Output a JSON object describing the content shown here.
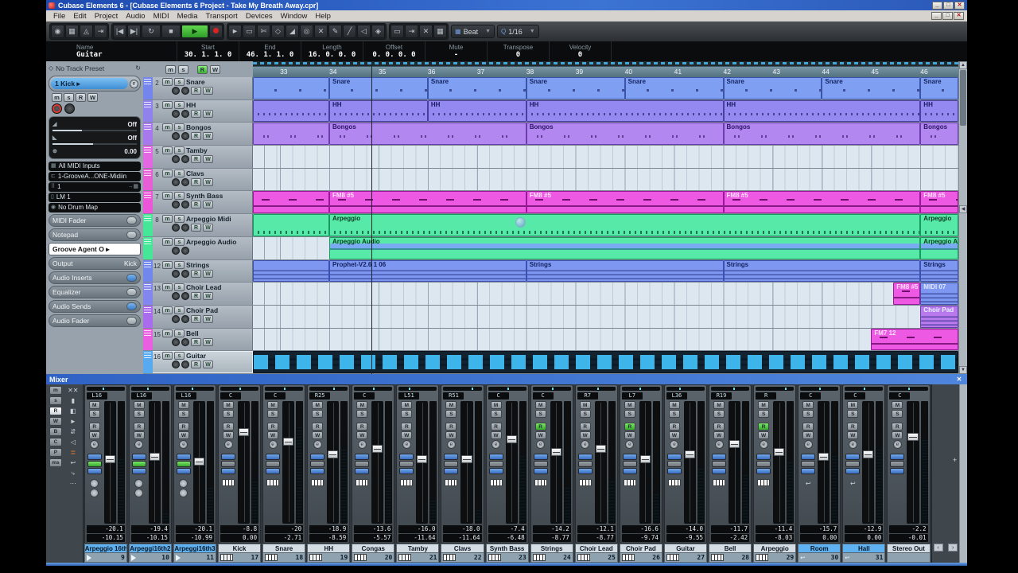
{
  "titlebar": {
    "title": "Cubase Elements 6 - [Cubase Elements 6 Project - Take My Breath Away.cpr]"
  },
  "menubar": {
    "items": [
      "File",
      "Edit",
      "Project",
      "Audio",
      "MIDI",
      "Media",
      "Transport",
      "Devices",
      "Window",
      "Help"
    ]
  },
  "toolbar": {
    "left_buttons": [
      {
        "name": "activate-button",
        "glyph": "◉"
      },
      {
        "name": "setup-button",
        "glyph": "▦"
      },
      {
        "name": "metronome-button",
        "glyph": "◬"
      },
      {
        "name": "automation-read-write-button",
        "glyph": "⇥"
      }
    ],
    "transport": [
      {
        "name": "goto-previous-marker-button",
        "glyph": "|◀"
      },
      {
        "name": "goto-next-marker-button",
        "glyph": "▶|"
      },
      {
        "name": "cycle-button",
        "glyph": "↻"
      },
      {
        "name": "stop-button",
        "glyph": "■"
      },
      {
        "name": "play-button",
        "glyph": "▶"
      },
      {
        "name": "record-button",
        "glyph": ""
      }
    ],
    "tools": [
      {
        "name": "object-select-tool",
        "glyph": "►"
      },
      {
        "name": "range-select-tool",
        "glyph": "▭"
      },
      {
        "name": "split-tool",
        "glyph": "✄"
      },
      {
        "name": "glue-tool",
        "glyph": "◇"
      },
      {
        "name": "erase-tool",
        "glyph": "◢"
      },
      {
        "name": "zoom-tool",
        "glyph": "◎"
      },
      {
        "name": "mute-tool",
        "glyph": "✕"
      },
      {
        "name": "draw-tool",
        "glyph": "✎"
      },
      {
        "name": "line-tool",
        "glyph": "╱"
      },
      {
        "name": "play-tool",
        "glyph": "◁"
      },
      {
        "name": "color-tool",
        "glyph": "◈"
      }
    ],
    "right_buttons": [
      {
        "name": "autoscroll-button",
        "glyph": "▭"
      },
      {
        "name": "snap-button",
        "glyph": "⇥"
      },
      {
        "name": "snap-type-button",
        "glyph": "✕"
      },
      {
        "name": "grid-type-button",
        "glyph": "▦"
      }
    ],
    "grid_mode": "Beat",
    "quantize_label": "Q",
    "quantize": "1/16"
  },
  "info_line": {
    "fields": [
      {
        "label": "Name",
        "value": "Guitar"
      },
      {
        "label": "Start",
        "value": "30. 1. 1. 0"
      },
      {
        "label": "End",
        "value": "46. 1. 1. 0"
      },
      {
        "label": "Length",
        "value": "16. 0. 0. 0"
      },
      {
        "label": "Offset",
        "value": "0. 0. 0. 0"
      },
      {
        "label": "Mute",
        "value": "-"
      },
      {
        "label": "Transpose",
        "value": "0"
      },
      {
        "label": "Velocity",
        "value": "0"
      }
    ]
  },
  "inspector": {
    "preset_label": "No Track Preset",
    "track_number": "1",
    "track_name": "Kick",
    "buttons": [
      "m",
      "s",
      "R",
      "W"
    ],
    "fader": {
      "vol1": "Off",
      "vol2": "Off",
      "pan": "0.00"
    },
    "input": "All MIDI Inputs",
    "routing": "1-GrooveA...ONE-Midiin",
    "channel": "1",
    "instrument": "LM 1",
    "drum_map": "No Drum Map",
    "sections": [
      {
        "label": "MIDI Fader",
        "style": "plain"
      },
      {
        "label": "Notepad",
        "style": "plain"
      },
      {
        "label": "Groove Agent O",
        "style": "combo"
      },
      {
        "label": "Output",
        "value": "Kick",
        "style": "output"
      },
      {
        "label": "Audio Inserts",
        "style": "blue"
      },
      {
        "label": "Equalizer",
        "style": "plain"
      },
      {
        "label": "Audio Sends",
        "style": "blue"
      },
      {
        "label": "Audio Fader",
        "style": "plain"
      }
    ]
  },
  "track_header": {
    "buttons": [
      "m",
      "s",
      "R",
      "W"
    ]
  },
  "view": {
    "bar_start": 32.45,
    "bar_end": 46.77,
    "playhead_bar": 34.85
  },
  "ruler": {
    "bars": [
      "33",
      "34",
      "35",
      "36",
      "37",
      "38",
      "39",
      "40",
      "41",
      "42",
      "43",
      "44",
      "45",
      "46"
    ]
  },
  "tracks": [
    {
      "num": "2",
      "name": "Snare",
      "color": "#7585ee",
      "clip_bg": "#7e9ff2",
      "clip_border": "#3b54aa",
      "pattern": "dots-sparse",
      "label_color": "#14235e",
      "clips": [
        [
          32.45,
          34,
          ""
        ],
        [
          34,
          36,
          "Snare"
        ],
        [
          36,
          38,
          "Snare"
        ],
        [
          38,
          40,
          "Snare"
        ],
        [
          40,
          42,
          "Snare"
        ],
        [
          42,
          44,
          "Snare"
        ],
        [
          44,
          46,
          "Snare"
        ],
        [
          46,
          46.77,
          "Snare"
        ]
      ]
    },
    {
      "num": "3",
      "name": "HH",
      "color": "#8f82ee",
      "clip_bg": "#9489f0",
      "clip_border": "#4a3fa0",
      "pattern": "dots-dense",
      "label_color": "#1c1a66",
      "clips": [
        [
          32.45,
          34,
          ""
        ],
        [
          34,
          36,
          "HH"
        ],
        [
          36,
          38,
          "HH"
        ],
        [
          38,
          42,
          "HH"
        ],
        [
          42,
          46,
          "HH"
        ],
        [
          46,
          46.77,
          "HH"
        ]
      ]
    },
    {
      "num": "4",
      "name": "Bongos",
      "color": "#a878ee",
      "clip_bg": "#b287f0",
      "clip_border": "#6a3cae",
      "pattern": "dots-pairs",
      "label_color": "#2c1466",
      "clips": [
        [
          32.45,
          34,
          ""
        ],
        [
          34,
          38,
          "Bongos"
        ],
        [
          38,
          42,
          "Bongos"
        ],
        [
          42,
          46,
          "Bongos"
        ],
        [
          46,
          46.77,
          "Bongos"
        ]
      ]
    },
    {
      "num": "5",
      "name": "Tamby",
      "color": "#e366e2",
      "clips": []
    },
    {
      "num": "6",
      "name": "Clavs",
      "color": "#e85ed6",
      "clips": []
    },
    {
      "num": "7",
      "name": "Synth Bass",
      "color": "#ee56da",
      "clip_bg": "#ee59e4",
      "clip_border": "#99189a",
      "pattern": "bass",
      "label_color": "#ffe2fb",
      "clips": [
        [
          32.45,
          34,
          ""
        ],
        [
          34,
          38,
          "FM8 #5"
        ],
        [
          38,
          42,
          "FM8 #5"
        ],
        [
          42,
          46,
          "FM8 #5"
        ],
        [
          46,
          46.77,
          "FM8 #5"
        ]
      ]
    },
    {
      "num": "8",
      "name": "Arpeggio Midi",
      "color": "#46e698",
      "clip_bg": "#57e9a7",
      "clip_border": "#169a5e",
      "pattern": "ticks",
      "label_color": "#0c3a22",
      "clips": [
        [
          32.45,
          34,
          ""
        ],
        [
          34,
          46,
          "Arpeggio"
        ],
        [
          46,
          46.77,
          "Arpeggio"
        ]
      ]
    },
    {
      "num": "",
      "name": "Arpeggio Audio",
      "color": "#46e698",
      "rw": false,
      "clip_bg": "#57e9a7",
      "clip_border": "#169a5e",
      "pattern": "wave",
      "label_color": "#0c3a22",
      "clips": [
        [
          34,
          46,
          "Arpeggio Audio"
        ],
        [
          46,
          46.77,
          "Arpeggio Au"
        ]
      ]
    },
    {
      "num": "12",
      "name": "Strings",
      "color": "#7287ee",
      "clip_bg": "#7e97f0",
      "clip_border": "#3b50b0",
      "pattern": "lines",
      "label_color": "#121f5e",
      "clips": [
        [
          32.45,
          34,
          ""
        ],
        [
          34,
          38,
          "Prophet-V2.6 1 06"
        ],
        [
          38,
          42,
          "Strings"
        ],
        [
          42,
          46,
          "Strings"
        ],
        [
          46,
          46.77,
          "Strings"
        ]
      ]
    },
    {
      "num": "13",
      "name": "Choir Lead",
      "color": "#8286ee",
      "clips": [
        {
          "from": 45.45,
          "to": 46,
          "label": "FM8 #5",
          "bg": "#ee59e4",
          "border": "#99189a",
          "pattern": "bass",
          "lc": "#ffe2fb"
        },
        {
          "from": 46,
          "to": 46.77,
          "label": "MIDI 07",
          "bg": "#7e97f0",
          "border": "#3b50b0",
          "pattern": "lines",
          "lc": "#e2e8ff"
        }
      ]
    },
    {
      "num": "14",
      "name": "Choir Pad",
      "color": "#aa6cee",
      "clips": [
        {
          "from": 46,
          "to": 46.77,
          "label": "Choir Pad",
          "bg": "#b878ee",
          "border": "#6a3cae",
          "pattern": "lines",
          "lc": "#e6f4ff"
        }
      ]
    },
    {
      "num": "15",
      "name": "Bell",
      "color": "#ea5ee2",
      "clips": [
        {
          "from": 45.0,
          "to": 46.77,
          "label": "FM7 12",
          "bg": "#ee59e4",
          "border": "#99189a",
          "pattern": "bass",
          "lc": "#ffe2fb"
        }
      ]
    },
    {
      "num": "16",
      "name": "Guitar",
      "color": "#58aaf0",
      "selected": true,
      "clips": [
        {
          "from": 32.45,
          "to": 46.77,
          "label": "",
          "bg": "#13222f",
          "border": "#0a141e",
          "pattern": "guitar",
          "lc": "#fff"
        }
      ]
    }
  ],
  "mixer": {
    "title": "Mixer",
    "strip_buttons": [
      "M",
      "S",
      "R",
      "W",
      "e"
    ],
    "strips": [
      {
        "name": "Arpeggio 16th",
        "num": "9",
        "pan": "L16",
        "val_top": "-20.1",
        "val_bottom": "-10.15",
        "kind": "audio",
        "tab": "blue",
        "fader": 0.44,
        "meter": 0.52
      },
      {
        "name": "Arpeggi16th2",
        "num": "10",
        "pan": "L16",
        "val_top": "-19.4",
        "val_bottom": "-10.15",
        "kind": "audio",
        "tab": "blue",
        "fader": 0.42,
        "meter": 0.08
      },
      {
        "name": "Arpeggi16th3",
        "num": "11",
        "pan": "L16",
        "val_top": "-20.1",
        "val_bottom": "-10.99",
        "kind": "audio",
        "tab": "blue",
        "fader": 0.46,
        "meter": 0.3
      },
      {
        "name": "Kick",
        "num": "17",
        "pan": "C",
        "val_top": "-8.8",
        "val_bottom": "0.00",
        "kind": "midi",
        "tab": "gray",
        "fader": 0.22,
        "meter": 0.35
      },
      {
        "name": "Snare",
        "num": "18",
        "pan": "C",
        "val_top": "-20",
        "val_bottom": "-2.71",
        "kind": "midi",
        "tab": "gray",
        "fader": 0.3,
        "meter": 0.78
      },
      {
        "name": "HH",
        "num": "19",
        "pan": "R25",
        "val_top": "-18.9",
        "val_bottom": "-8.59",
        "kind": "midi",
        "tab": "gray",
        "fader": 0.4,
        "meter": 0.6
      },
      {
        "name": "Congas",
        "num": "20",
        "pan": "C",
        "val_top": "-13.6",
        "val_bottom": "-5.57",
        "kind": "midi",
        "tab": "gray",
        "fader": 0.36,
        "meter": 0.42
      },
      {
        "name": "Tamby",
        "num": "21",
        "pan": "L51",
        "val_top": "-16.0",
        "val_bottom": "-11.64",
        "kind": "midi",
        "tab": "gray",
        "fader": 0.44,
        "meter": 0.18
      },
      {
        "name": "Clavs",
        "num": "22",
        "pan": "R51",
        "val_top": "-18.0",
        "val_bottom": "-11.64",
        "kind": "midi",
        "tab": "gray",
        "fader": 0.44,
        "meter": 0.12
      },
      {
        "name": "Synth Bass",
        "num": "23",
        "pan": "C",
        "val_top": "-7.4",
        "val_bottom": "-6.48",
        "kind": "midi",
        "tab": "gray",
        "fader": 0.28,
        "meter": 0.55
      },
      {
        "name": "Strings",
        "num": "24",
        "pan": "C",
        "val_top": "-14.2",
        "val_bottom": "-8.77",
        "kind": "midi",
        "tab": "gray",
        "fader": 0.38,
        "meter": 0.3,
        "r_on": true
      },
      {
        "name": "Choir Lead",
        "num": "25",
        "pan": "R7",
        "val_top": "-12.1",
        "val_bottom": "-8.77",
        "kind": "midi",
        "tab": "gray",
        "fader": 0.36,
        "meter": 0.35
      },
      {
        "name": "Choir Pad",
        "num": "26",
        "pan": "L7",
        "val_top": "-16.6",
        "val_bottom": "-9.74",
        "kind": "midi",
        "tab": "gray",
        "fader": 0.44,
        "meter": 0.25,
        "r_on": true
      },
      {
        "name": "Guitar",
        "num": "27",
        "pan": "L36",
        "val_top": "-14.0",
        "val_bottom": "-9.55",
        "kind": "midi",
        "tab": "gray",
        "fader": 0.4,
        "meter": 0.45
      },
      {
        "name": "Bell",
        "num": "28",
        "pan": "R19",
        "val_top": "-11.7",
        "val_bottom": "-2.42",
        "kind": "midi",
        "tab": "gray",
        "fader": 0.32,
        "meter": 0.4
      },
      {
        "name": "Arpeggio",
        "num": "29",
        "pan": "R",
        "val_top": "-11.4",
        "val_bottom": "-8.03",
        "kind": "midi",
        "tab": "gray",
        "fader": 0.38,
        "meter": 0.5,
        "r_on": true
      },
      {
        "name": "Room",
        "num": "30",
        "pan": "C",
        "val_top": "-15.7",
        "val_bottom": "0.00",
        "kind": "fx",
        "tab": "blue",
        "fader": 0.42,
        "meter": 0.55
      },
      {
        "name": "Hall",
        "num": "31",
        "pan": "C",
        "val_top": "-12.9",
        "val_bottom": "0.00",
        "kind": "fx",
        "tab": "blue",
        "fader": 0.4,
        "meter": 0.6
      },
      {
        "name": "Stereo Out",
        "num": "",
        "pan": "C",
        "val_top": "-2.2",
        "val_bottom": "-0.01",
        "kind": "out",
        "tab": "gray",
        "fader": 0.26,
        "meter": 0.68
      }
    ]
  },
  "colors": {
    "accent_blue": "#5fb2f2",
    "meter_cyan": "#55dce8",
    "play_green": "#4cc44c",
    "record_red": "#d22020"
  }
}
